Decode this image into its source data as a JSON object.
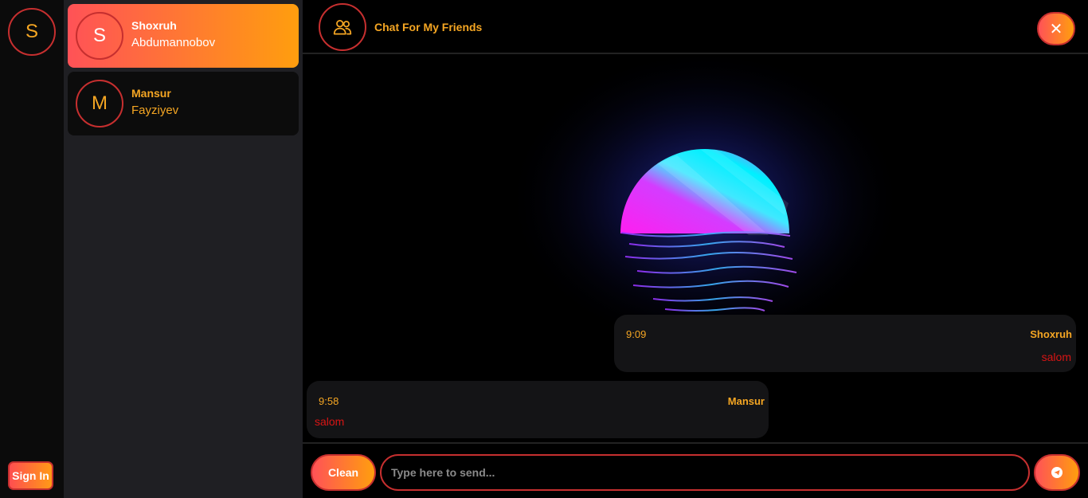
{
  "user": {
    "initial": "S",
    "sign_in_label": "Sign In"
  },
  "contacts": [
    {
      "initial": "S",
      "first_name": "Shoxruh",
      "last_name": "Abdumannobov",
      "active": true
    },
    {
      "initial": "M",
      "first_name": "Mansur",
      "last_name": "Fayziyev",
      "active": false
    }
  ],
  "chat": {
    "title": "Chat For My Friends",
    "close_icon": "close-icon",
    "group_icon": "users-icon",
    "messages": [
      {
        "time": "9:09",
        "author": "Shoxruh",
        "text": "salom"
      },
      {
        "time": "9:58",
        "author": "Mansur",
        "text": "salom"
      }
    ]
  },
  "composer": {
    "clean_label": "Clean",
    "placeholder": "Type here to send...",
    "send_icon": "telegram-send-icon"
  },
  "colors": {
    "accent": "#f5a623",
    "gradient_start": "#ff5257",
    "gradient_end": "#ff9e0e",
    "border": "#c62f2f",
    "message_text": "#d81414"
  }
}
